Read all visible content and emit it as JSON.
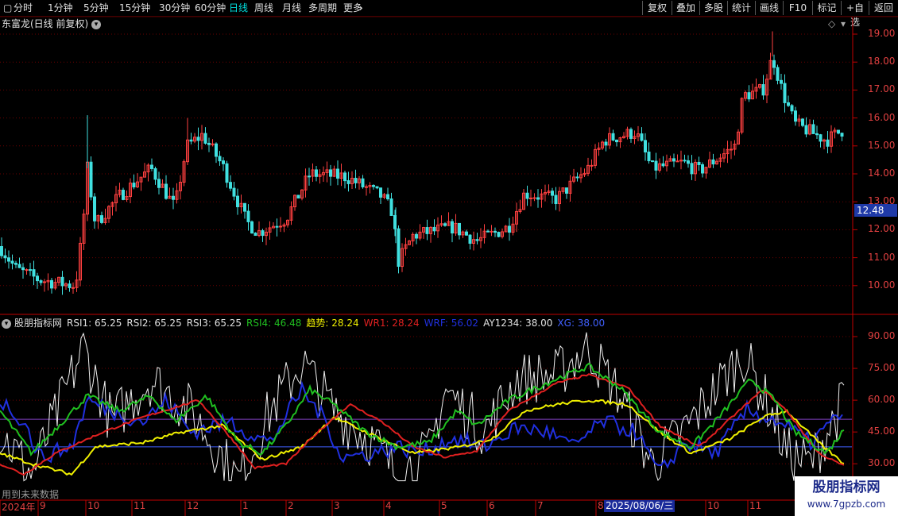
{
  "toolbar": {
    "periods": [
      "分时",
      "1分钟",
      "5分钟",
      "15分钟",
      "30分钟",
      "60分钟",
      "日线",
      "周线",
      "月线",
      "多周期",
      "更多"
    ],
    "active_period": "日线",
    "right_buttons": [
      "复权",
      "叠加",
      "多股",
      "统计",
      "画线",
      "F10",
      "标记",
      "+自选",
      "返回"
    ]
  },
  "main": {
    "title": "东富龙(日线 前复权)",
    "price_ticks": [
      "19.00",
      "18.00",
      "17.00",
      "16.00",
      "15.00",
      "14.00",
      "13.00",
      "12.00",
      "11.00",
      "10.00"
    ],
    "current_price": "12.48"
  },
  "indicator": {
    "name": "股朋指标网",
    "items": [
      {
        "label": "RSI1: 65.25",
        "color": "#e0e0e0"
      },
      {
        "label": "RSI2: 65.25",
        "color": "#e0e0e0"
      },
      {
        "label": "RSI3: 65.25",
        "color": "#e0e0e0"
      },
      {
        "label": "RSI4: 46.48",
        "color": "#20c020"
      },
      {
        "label": "趋势: 28.24",
        "color": "#f0f000"
      },
      {
        "label": "WR1: 28.24",
        "color": "#e02020"
      },
      {
        "label": "WRF: 56.02",
        "color": "#2030e0"
      },
      {
        "label": "AY1234: 38.00",
        "color": "#e0e0e0"
      },
      {
        "label": "XG: 38.00",
        "color": "#4060ff"
      }
    ],
    "ticks": [
      "90.00",
      "75.00",
      "60.00",
      "45.00",
      "30.00"
    ],
    "note": "用到未来数据"
  },
  "xaxis": {
    "labels": [
      "2024年",
      "9",
      "10",
      "11",
      "12",
      "1",
      "2",
      "3",
      "4",
      "5",
      "6",
      "7",
      "8",
      "10",
      "11"
    ],
    "highlight_date": "2025/08/06/三"
  },
  "watermark": {
    "title": "股朋指标网",
    "url": "www.7gpzb.com"
  },
  "colors": {
    "up": "#ff4040",
    "down": "#40e0e0",
    "axis": "#c00000"
  }
}
